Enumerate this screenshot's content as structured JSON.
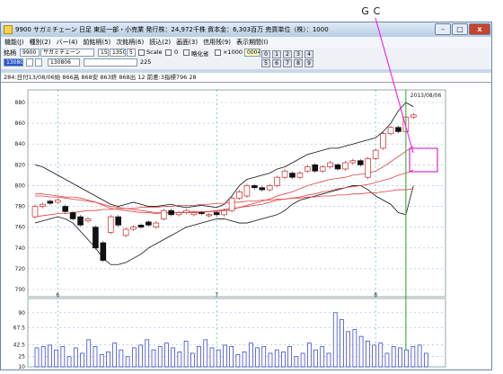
{
  "annotation": {
    "label": "ＧＣ",
    "arrow_color": "#ff00ff"
  },
  "window": {
    "title": "9900 サガミチェーン 日足 東証一部・小売業 発行株：24,972千株 資本金：6,303百万 売買単位（株）：1000",
    "min_label": "–",
    "max_label": "□",
    "close_label": "x"
  },
  "menu": [
    "機能(J)",
    "種別(2)",
    "バー(4)",
    "前銘柄(5)",
    "次銘柄(6)",
    "読込(2)",
    "画面(3)",
    "信用残(9)",
    "表示期間(I)"
  ],
  "toolbar": {
    "code_label": "銘柄",
    "code_value": "9900",
    "name_value": "サガミチェーン",
    "range_value": "15",
    "price_value": "1350",
    "step_value": "5",
    "scale_label": "Scale",
    "zero_value": "0",
    "log_label": "略化省",
    "multiplier_label": "×1000",
    "counter_value": "0004",
    "date_value": "130806",
    "date2_value": "130806",
    "page_value": "225",
    "grid_buttons": [
      "0",
      "1",
      "2",
      "3",
      "4",
      "5",
      "6",
      "7",
      "8",
      "9"
    ]
  },
  "info_line": "284:日付13/08/06始 866高 868安 863終 868出 12 前差:3指標796 28",
  "chart_data": [
    {
      "type": "candlestick",
      "date_label": "2013/08/06",
      "ylim": [
        700,
        880
      ],
      "yticks": [
        700,
        720,
        740,
        760,
        780,
        800,
        820,
        840,
        860,
        880
      ],
      "xticks": [
        "6",
        "7",
        "8"
      ],
      "candles": [
        {
          "o": 770,
          "c": 780
        },
        {
          "o": 780,
          "c": 782
        },
        {
          "o": 785,
          "c": 783
        },
        {
          "o": 784,
          "c": 786
        },
        {
          "o": 780,
          "c": 775
        },
        {
          "o": 774,
          "c": 768
        },
        {
          "o": 770,
          "c": 762
        },
        {
          "o": 766,
          "c": 768
        },
        {
          "o": 760,
          "c": 740
        },
        {
          "o": 745,
          "c": 728
        },
        {
          "o": 755,
          "c": 770
        },
        {
          "o": 770,
          "c": 762
        },
        {
          "o": 752,
          "c": 758
        },
        {
          "o": 758,
          "c": 760
        },
        {
          "o": 762,
          "c": 760
        },
        {
          "o": 765,
          "c": 762
        },
        {
          "o": 760,
          "c": 764
        },
        {
          "o": 768,
          "c": 776
        },
        {
          "o": 776,
          "c": 772
        },
        {
          "o": 772,
          "c": 774
        },
        {
          "o": 774,
          "c": 776
        },
        {
          "o": 772,
          "c": 774
        },
        {
          "o": 774,
          "c": 773
        },
        {
          "o": 772,
          "c": 772
        },
        {
          "o": 774,
          "c": 772
        },
        {
          "o": 772,
          "c": 776
        },
        {
          "o": 776,
          "c": 788
        },
        {
          "o": 788,
          "c": 794
        },
        {
          "o": 790,
          "c": 800
        },
        {
          "o": 800,
          "c": 798
        },
        {
          "o": 798,
          "c": 796
        },
        {
          "o": 796,
          "c": 800
        },
        {
          "o": 800,
          "c": 808
        },
        {
          "o": 808,
          "c": 814
        },
        {
          "o": 812,
          "c": 808
        },
        {
          "o": 808,
          "c": 812
        },
        {
          "o": 814,
          "c": 818
        },
        {
          "o": 820,
          "c": 814
        },
        {
          "o": 814,
          "c": 818
        },
        {
          "o": 818,
          "c": 822
        },
        {
          "o": 820,
          "c": 816
        },
        {
          "o": 816,
          "c": 822
        },
        {
          "o": 822,
          "c": 824
        },
        {
          "o": 824,
          "c": 820
        },
        {
          "o": 808,
          "c": 826
        },
        {
          "o": 826,
          "c": 834
        },
        {
          "o": 836,
          "c": 850
        },
        {
          "o": 850,
          "c": 856
        },
        {
          "o": 856,
          "c": 852
        },
        {
          "o": 852,
          "c": 866
        },
        {
          "o": 866,
          "c": 868
        }
      ],
      "ma_short": [
        790,
        790,
        789,
        789,
        788,
        787,
        786,
        785,
        784,
        781,
        778,
        777,
        776,
        775,
        774,
        774,
        773,
        774,
        774,
        774,
        775,
        775,
        775,
        775,
        775,
        776,
        777,
        779,
        781,
        783,
        785,
        787,
        790,
        792,
        794,
        797,
        800,
        802,
        804,
        806,
        807,
        808,
        810,
        811,
        812,
        814,
        818,
        823,
        828,
        833,
        838
      ],
      "ma_mid": [
        792,
        792,
        791,
        790,
        789,
        789,
        788,
        786,
        784,
        782,
        780,
        779,
        778,
        777,
        776,
        775,
        774,
        774,
        774,
        774,
        774,
        774,
        774,
        775,
        776,
        777,
        778,
        779,
        780,
        781,
        782,
        784,
        786,
        787,
        788,
        789,
        791,
        792,
        794,
        795,
        797,
        798,
        799,
        800,
        801,
        803,
        805,
        807,
        810,
        812,
        815
      ],
      "ma_long": [
        770,
        771,
        772,
        773,
        773,
        774,
        775,
        776,
        776,
        777,
        777,
        778,
        778,
        778,
        779,
        779,
        779,
        780,
        780,
        781,
        781,
        781,
        782,
        782,
        783,
        783,
        784,
        784,
        785,
        785,
        786,
        786,
        787,
        787,
        788,
        788,
        789,
        789,
        790,
        790,
        791,
        791,
        792,
        792,
        793,
        793,
        794,
        795,
        796,
        796,
        797
      ],
      "boll_upper": [
        820,
        818,
        814,
        810,
        806,
        802,
        798,
        794,
        790,
        786,
        782,
        780,
        782,
        784,
        782,
        780,
        780,
        781,
        782,
        780,
        779,
        780,
        781,
        780,
        779,
        782,
        790,
        800,
        806,
        808,
        810,
        812,
        816,
        818,
        822,
        826,
        830,
        832,
        834,
        836,
        836,
        838,
        840,
        842,
        844,
        846,
        852,
        860,
        872,
        880,
        876
      ],
      "boll_lower": [
        764,
        766,
        768,
        770,
        768,
        764,
        756,
        748,
        740,
        730,
        724,
        724,
        726,
        730,
        734,
        740,
        744,
        748,
        752,
        756,
        760,
        762,
        764,
        766,
        768,
        768,
        766,
        764,
        764,
        766,
        768,
        770,
        772,
        776,
        782,
        786,
        788,
        790,
        792,
        794,
        796,
        798,
        800,
        800,
        796,
        790,
        786,
        782,
        774,
        772,
        800
      ],
      "cross_marker": {
        "index": 49
      }
    },
    {
      "type": "bar",
      "ylim": [
        10,
        95
      ],
      "yticks": [
        10,
        25,
        42.5,
        67.5,
        90
      ],
      "ytick_labels": [
        "10",
        "25",
        "42.5",
        "67.5",
        "90"
      ],
      "values": [
        38,
        40,
        42,
        35,
        40,
        25,
        38,
        30,
        50,
        40,
        28,
        32,
        45,
        35,
        25,
        38,
        42,
        50,
        35,
        40,
        45,
        38,
        32,
        48,
        30,
        40,
        50,
        38,
        35,
        42,
        40,
        28,
        32,
        45,
        38,
        40,
        30,
        35,
        32,
        40,
        25,
        30,
        45,
        35,
        40,
        30,
        90,
        80,
        62,
        65,
        55,
        48,
        42,
        45,
        30,
        40,
        38,
        35,
        40,
        42,
        30
      ]
    }
  ]
}
